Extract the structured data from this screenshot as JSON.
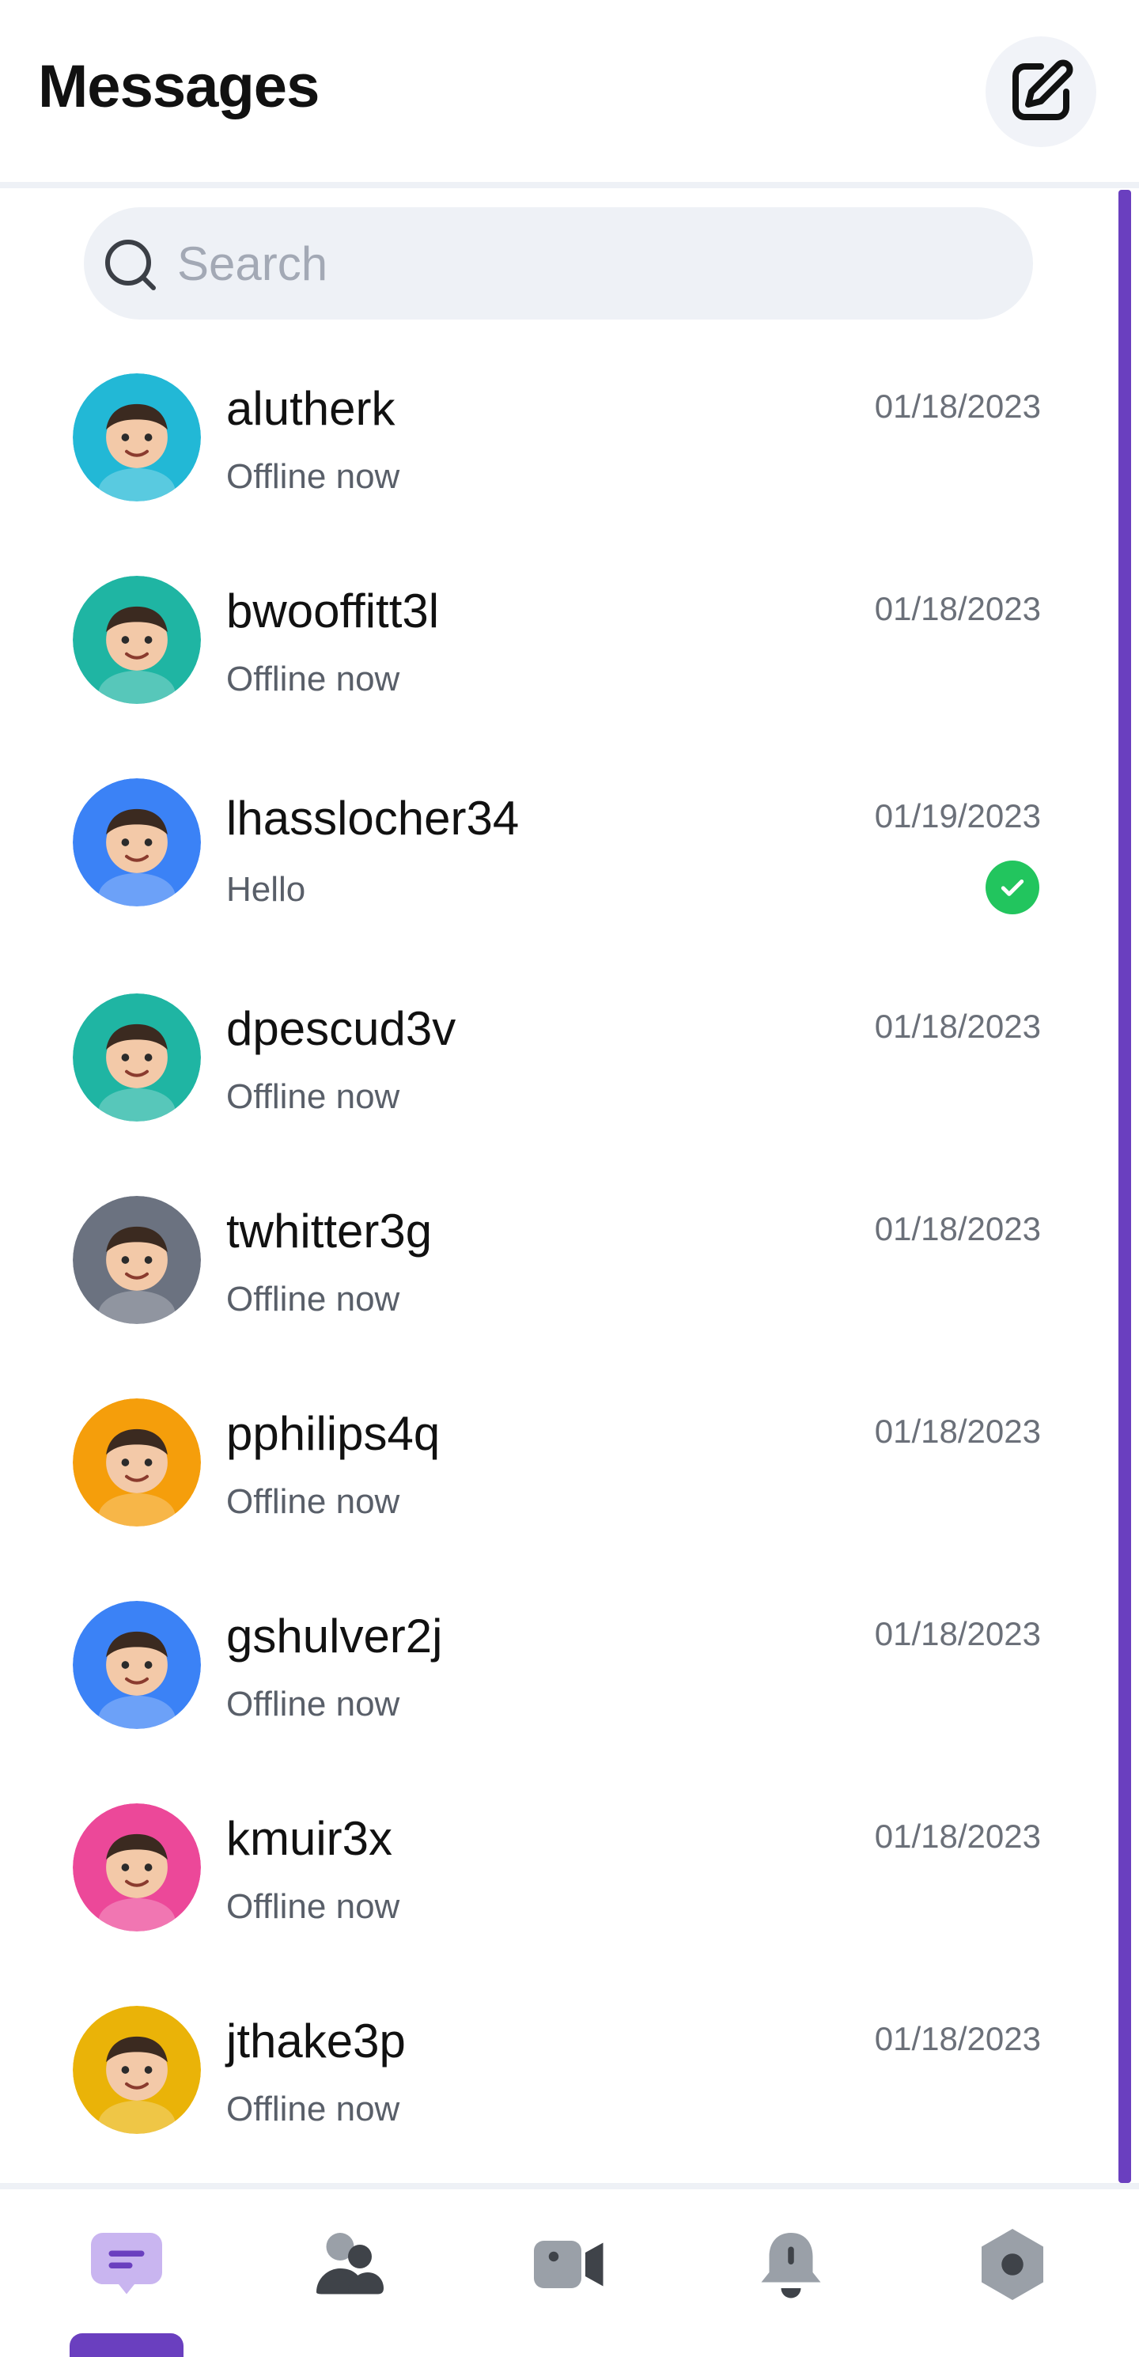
{
  "header": {
    "title": "Messages",
    "compose_icon": "compose-icon"
  },
  "search": {
    "placeholder": "Search",
    "value": ""
  },
  "conversations": [
    {
      "name": "alutherk",
      "status": "Offline now",
      "date": "01/18/2023",
      "avatar_bg": "#22b8d6",
      "read": false
    },
    {
      "name": "bwooffitt3l",
      "status": "Offline now",
      "date": "01/18/2023",
      "avatar_bg": "#1fb5a3",
      "read": false
    },
    {
      "name": "lhasslocher34",
      "status": "Hello",
      "date": "01/19/2023",
      "avatar_bg": "#3b82f6",
      "read": true
    },
    {
      "name": "dpescud3v",
      "status": "Offline now",
      "date": "01/18/2023",
      "avatar_bg": "#1fb5a3",
      "read": false
    },
    {
      "name": "twhitter3g",
      "status": "Offline now",
      "date": "01/18/2023",
      "avatar_bg": "#6b7280",
      "read": false
    },
    {
      "name": "pphilips4q",
      "status": "Offline now",
      "date": "01/18/2023",
      "avatar_bg": "#f59e0b",
      "read": false
    },
    {
      "name": "gshulver2j",
      "status": "Offline now",
      "date": "01/18/2023",
      "avatar_bg": "#3b82f6",
      "read": false
    },
    {
      "name": "kmuir3x",
      "status": "Offline now",
      "date": "01/18/2023",
      "avatar_bg": "#ec4899",
      "read": false
    },
    {
      "name": "jthake3p",
      "status": "Offline now",
      "date": "01/18/2023",
      "avatar_bg": "#eab308",
      "read": false
    }
  ],
  "bottom_nav": [
    {
      "icon": "chat-icon",
      "active": true
    },
    {
      "icon": "contacts-icon",
      "active": false
    },
    {
      "icon": "video-call-icon",
      "active": false
    },
    {
      "icon": "bell-icon",
      "active": false
    },
    {
      "icon": "settings-icon",
      "active": false
    }
  ],
  "colors": {
    "accent": "#6a3fbf",
    "accent_light": "#c9b5f0",
    "read_check": "#22c55e",
    "search_bg": "#eef1f6",
    "muted_text": "#595f69"
  }
}
